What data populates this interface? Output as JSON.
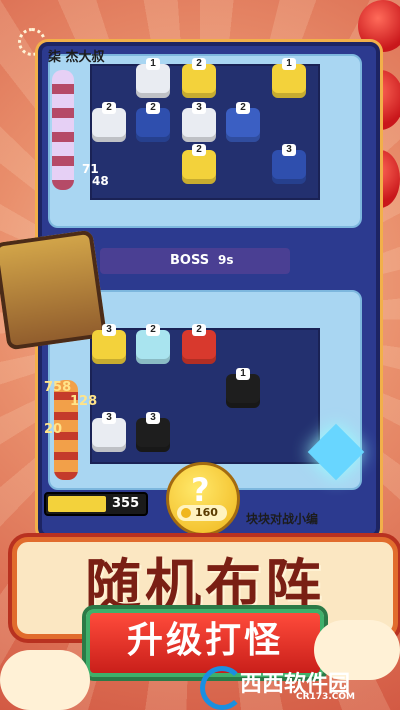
{
  "player": {
    "name": "柒 杰大叔"
  },
  "hud": {
    "num_top1": "71",
    "num_top2": "48",
    "num_low1": "758",
    "num_low2": "128",
    "num_low3": "20"
  },
  "boss": {
    "label": "BOSS",
    "timer": "9s"
  },
  "bottom": {
    "energy": "355",
    "question": "?",
    "cost": "160",
    "editor_tag": "块块对战小编"
  },
  "banner": {
    "title": "随机布阵",
    "subtitle": "升级打怪"
  },
  "watermark": {
    "brand": "西西软件园",
    "url": "CR173.COM"
  },
  "top_grid_levels": [
    "1",
    "2",
    "1",
    "2",
    "2",
    "3",
    "2",
    "2",
    "3"
  ],
  "bottom_grid_levels": [
    "3",
    "2",
    "2",
    "1",
    "3",
    "3"
  ],
  "colors": {
    "yellow": "#f3d23b",
    "white": "#e9ecf2",
    "blue": "#2f4fae",
    "red": "#d8392d",
    "black": "#1e1e1e"
  }
}
